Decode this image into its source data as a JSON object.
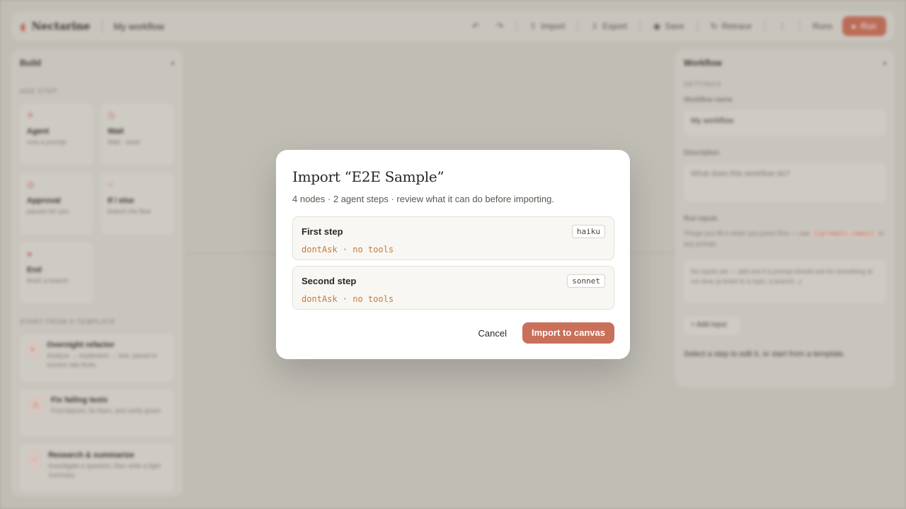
{
  "app": {
    "logo": "Nectarine",
    "workflow_name": "My workflow",
    "toolbar": {
      "undo_label": "↶",
      "redo_label": "↷",
      "import_label": "Import",
      "export_label": "Export",
      "save_label": "Save",
      "history_label": "Retrace",
      "menu_label": "⋮",
      "runs_label": "Runs",
      "run_label": "Run"
    },
    "build_panel": {
      "title": "Build",
      "add_step_heading": "ADD STEP",
      "steps": [
        {
          "icon": "✳",
          "title": "Agent",
          "subtitle": "runs a prompt"
        },
        {
          "icon": "◷",
          "title": "Wait",
          "subtitle": "Wait · reset"
        },
        {
          "icon": "◎",
          "title": "Approval",
          "subtitle": "pauses for you"
        },
        {
          "icon": "⑂",
          "title": "If / else",
          "subtitle": "branch the flow"
        },
        {
          "icon": "●",
          "title": "End",
          "subtitle": "finish a branch"
        }
      ],
      "templates_heading": "START FROM A TEMPLATE",
      "templates": [
        {
          "icon": "◐",
          "title": "Overnight refactor",
          "subtitle": "Analyze → implement → test, paced to survive rate limits"
        },
        {
          "icon": "⚠",
          "title": "Fix failing tests",
          "subtitle": "Find failures, fix them, and verify green"
        },
        {
          "icon": "◌",
          "title": "Research & summarize",
          "subtitle": "Investigate a question, then write a tight summary"
        }
      ]
    },
    "workflow_panel": {
      "title": "Workflow",
      "settings_heading": "SETTINGS",
      "name_label": "Workflow name",
      "name_value": "My workflow",
      "description_label": "Description",
      "description_placeholder": "What does this workflow do?",
      "inputs_label": "Run inputs",
      "inputs_hint": "Things you fill in when you press Run — use",
      "inputs_code": "{{prompts.name}}",
      "inputs_hint_tail": "in any prompt.",
      "inputs_placeholder": "No inputs yet — add one if a prompt should ask for something at run time (a ticket to a topic, a branch...)",
      "add_input_label": "+ Add input",
      "footer_hint": "Select a step to edit it, or start from a template."
    }
  },
  "modal": {
    "title": "Import “E2E Sample”",
    "subtitle": "4 nodes · 2 agent steps · review what it can do before importing.",
    "steps": [
      {
        "name": "First step",
        "model": "haiku",
        "meta": "dontAsk · no tools"
      },
      {
        "name": "Second step",
        "model": "sonnet",
        "meta": "dontAsk · no tools"
      }
    ],
    "cancel_label": "Cancel",
    "confirm_label": "Import to canvas"
  },
  "colors": {
    "accent": "#c9705a",
    "meta_text": "#c57a3a",
    "backdrop": "#b9b5ac"
  }
}
